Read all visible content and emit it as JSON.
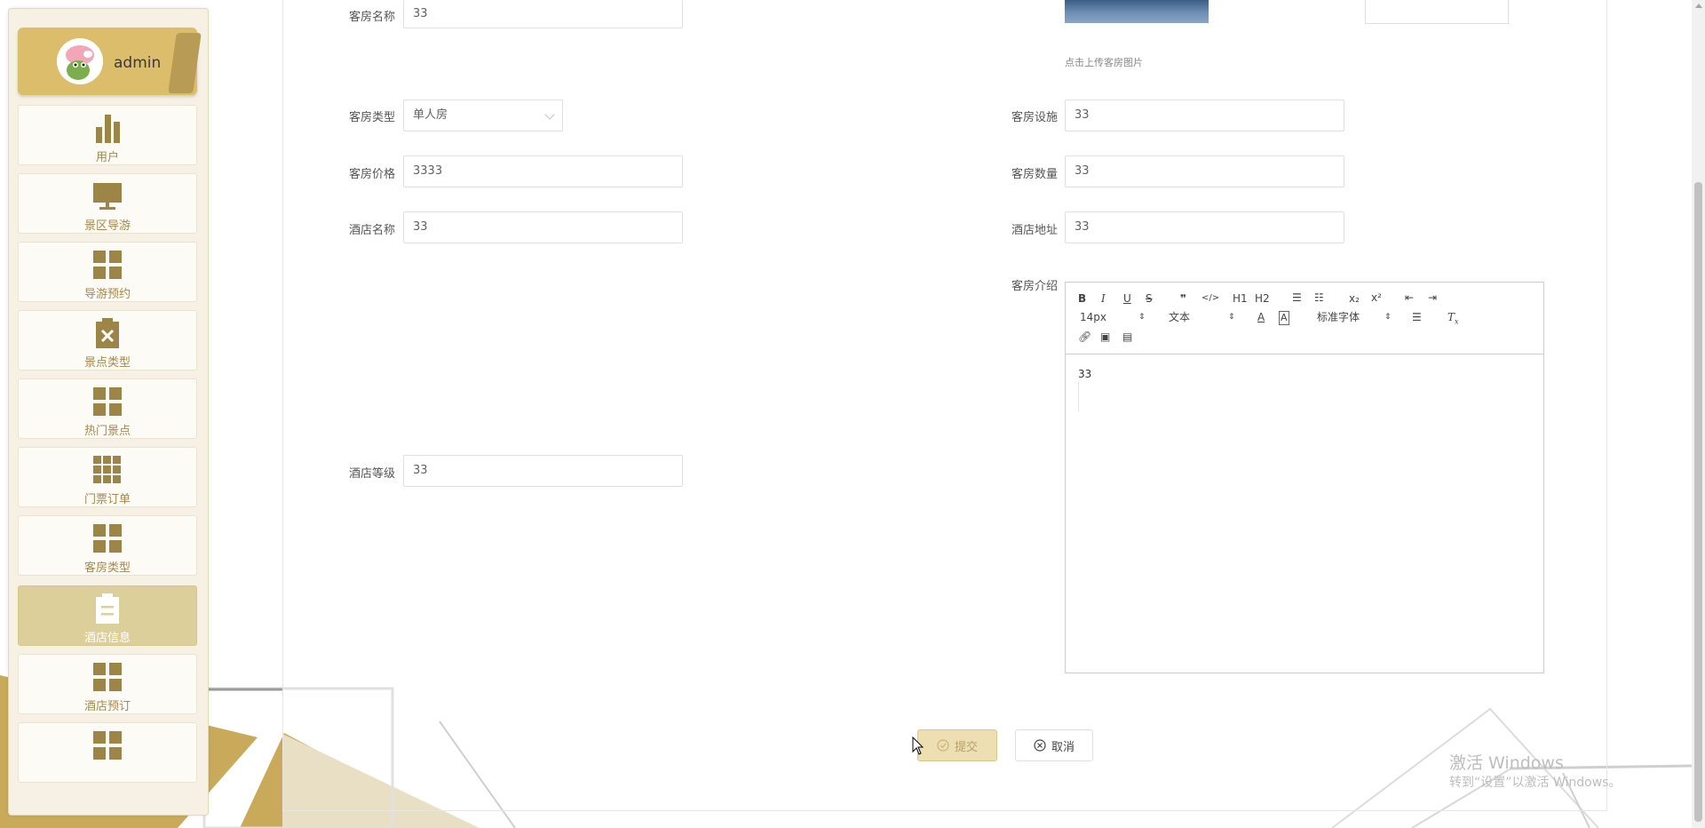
{
  "sidebar": {
    "username": "admin",
    "items": [
      {
        "label": "用户",
        "icon": "bar-chart-icon"
      },
      {
        "label": "景区导游",
        "icon": "monitor-icon"
      },
      {
        "label": "导游预约",
        "icon": "grid-icon"
      },
      {
        "label": "景点类型",
        "icon": "clipboard-x-icon"
      },
      {
        "label": "热门景点",
        "icon": "grid-icon"
      },
      {
        "label": "门票订单",
        "icon": "grid-nine-icon"
      },
      {
        "label": "客房类型",
        "icon": "grid-icon"
      },
      {
        "label": "酒店信息",
        "icon": "clipboard-icon",
        "active": true
      },
      {
        "label": "酒店预订",
        "icon": "grid-icon"
      },
      {
        "label": "",
        "icon": "grid-icon"
      }
    ]
  },
  "form": {
    "room_name_label": "客房名称",
    "room_name_value": "33",
    "upload_hint": "点击上传客房图片",
    "room_type_label": "客房类型",
    "room_type_value": "单人房",
    "room_facility_label": "客房设施",
    "room_facility_value": "33",
    "room_price_label": "客房价格",
    "room_price_value": "3333",
    "room_count_label": "客房数量",
    "room_count_value": "33",
    "hotel_name_label": "酒店名称",
    "hotel_name_value": "33",
    "hotel_address_label": "酒店地址",
    "hotel_address_value": "33",
    "room_intro_label": "客房介绍",
    "hotel_level_label": "酒店等级",
    "hotel_level_value": "33"
  },
  "editor": {
    "font_size": "14px",
    "block_format": "文本",
    "font_family": "标准字体",
    "content": "33",
    "h1": "H1",
    "h2": "H2"
  },
  "buttons": {
    "submit": "提交",
    "cancel": "取消"
  },
  "watermark": {
    "line1": "激活 Windows",
    "line2": "转到“设置”以激活 Windows。"
  },
  "colors": {
    "accent": "#dcbd6b",
    "sidebar_label": "#a8884a",
    "icon": "#9c8547"
  }
}
